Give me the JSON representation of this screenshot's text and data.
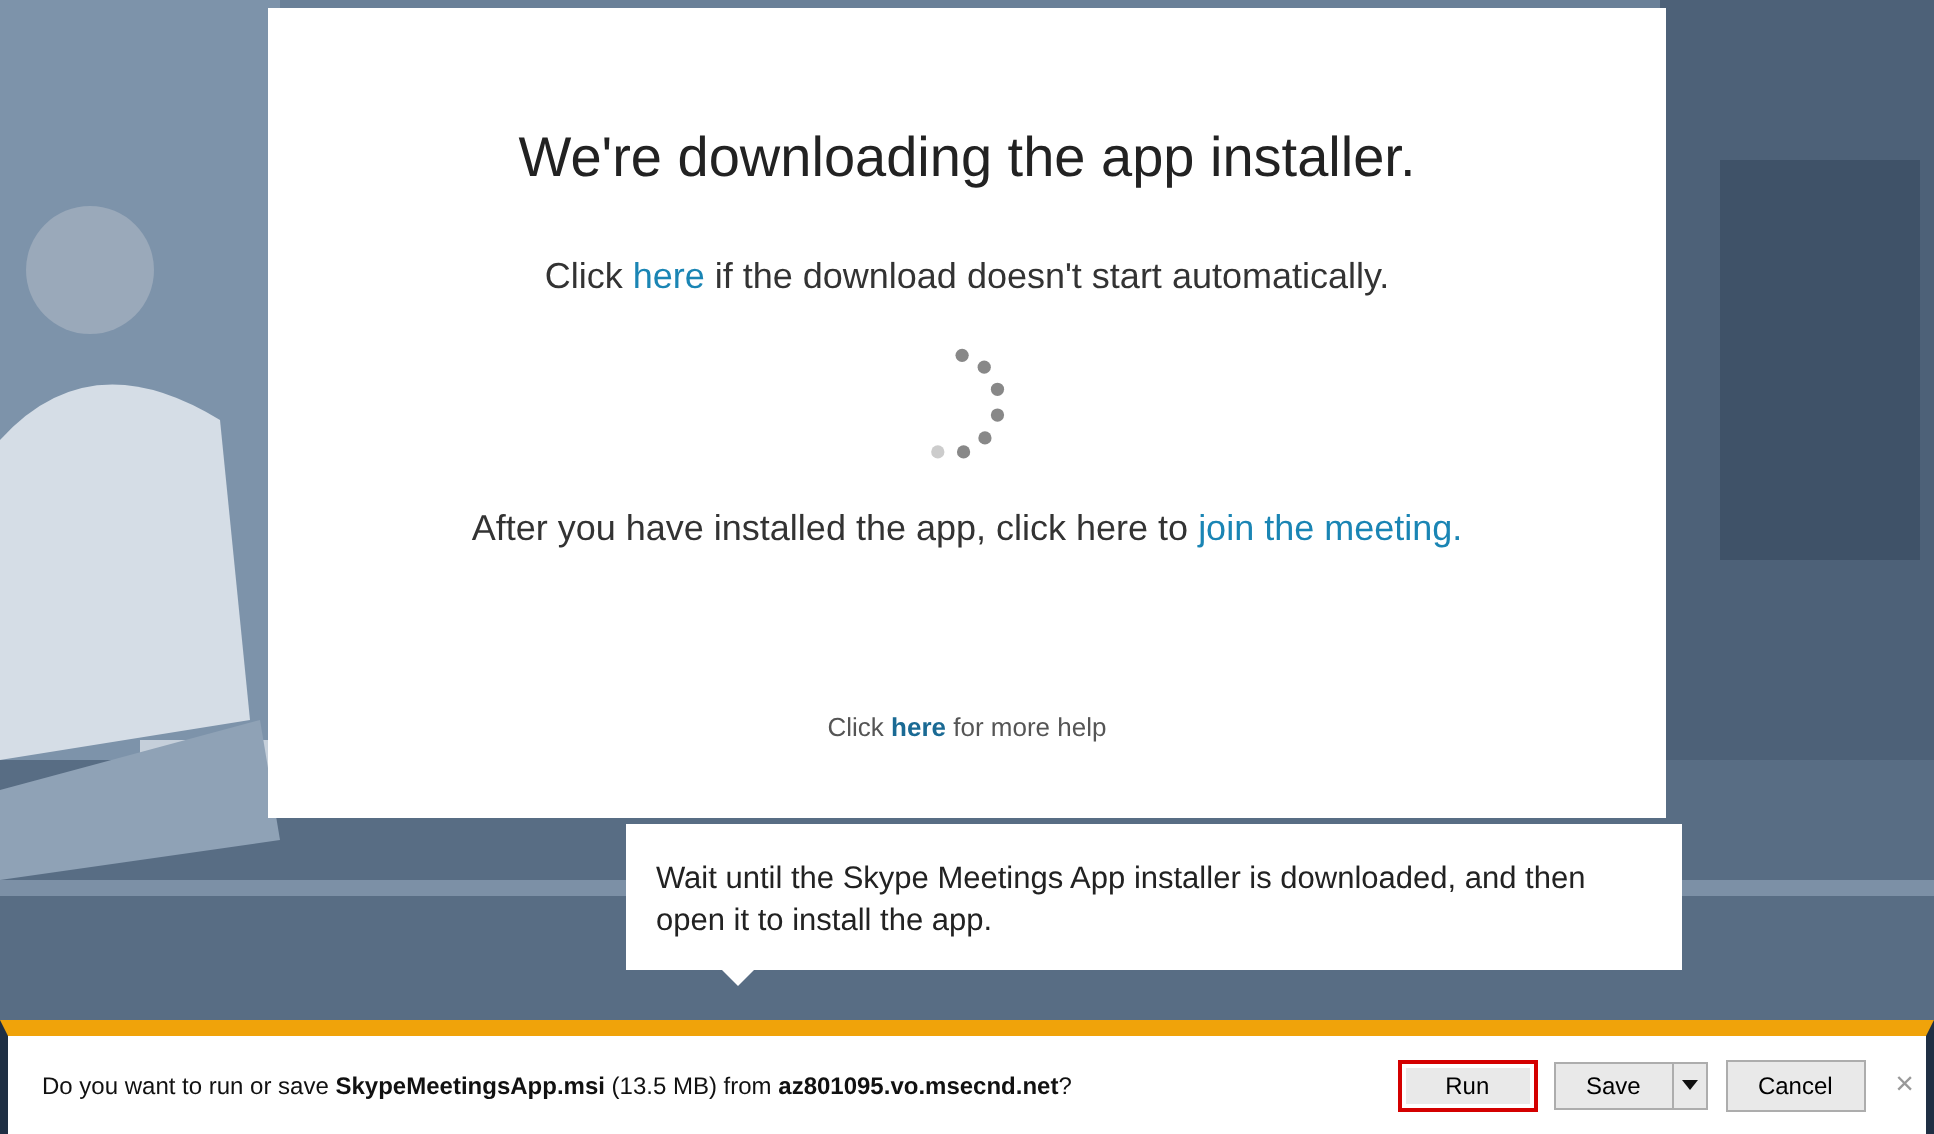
{
  "dialog": {
    "title": "We're downloading the app installer.",
    "download_line": {
      "before": "Click ",
      "link": "here",
      "after": " if the download doesn't start automatically."
    },
    "join_line": {
      "before": "After you have installed the app, click here to ",
      "link": "join the meeting."
    },
    "help_line": {
      "before": "Click ",
      "link": "here",
      "after": " for more help"
    }
  },
  "callout": {
    "text": "Wait until the Skype Meetings App installer is downloaded, and then open it to install the app."
  },
  "download_bar": {
    "message": "Do you want to run or save **SkypeMeetingsApp.msi** (13.5 MB) from **az801095.vo.msecnd.net**?",
    "buttons": [
      {
        "label": "Run",
        "kind": "plain",
        "selected": true
      },
      {
        "label": "Save",
        "kind": "split",
        "selected": false
      },
      {
        "label": "Cancel",
        "kind": "plain",
        "selected": false
      }
    ],
    "close": "×"
  }
}
